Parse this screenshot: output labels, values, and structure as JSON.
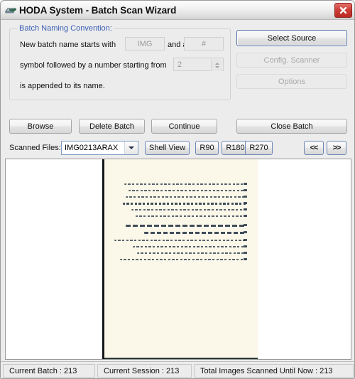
{
  "window": {
    "title": "HODA System - Batch Scan Wizard",
    "icon": "scanner-icon",
    "close_label": "close-icon"
  },
  "group": {
    "legend": "Batch Naming Convention:",
    "line1_prefix": "New batch name starts with",
    "line1_mid": "and a",
    "line2_prefix": "symbol followed by a number starting from",
    "line3": "is appended to its name.",
    "field_prefix_value": "IMG",
    "field_symbol_value": "#",
    "field_start_value": "2"
  },
  "actions": {
    "select_source": "Select Source",
    "config_scanner": "Config. Scanner",
    "options": "Options",
    "browse": "Browse",
    "delete_batch": "Delete Batch",
    "continue": "Continue",
    "close_batch": "Close Batch"
  },
  "files": {
    "label": "Scanned Files:",
    "selected": "IMG0213ARAX",
    "shell_view": "Shell View",
    "rotate_90": "R90",
    "rotate_180": "R180",
    "rotate_270": "R270",
    "prev": "<<",
    "next": ">>"
  },
  "status": {
    "batch": "Current Batch : 213",
    "session": "Current Session : 213",
    "total": "Total Images Scanned Until Now :  213"
  },
  "colors": {
    "accent": "#3b5fb5",
    "close_red": "#cf3f38",
    "page_background": "#fbf8e9",
    "window_background": "#ececec"
  }
}
